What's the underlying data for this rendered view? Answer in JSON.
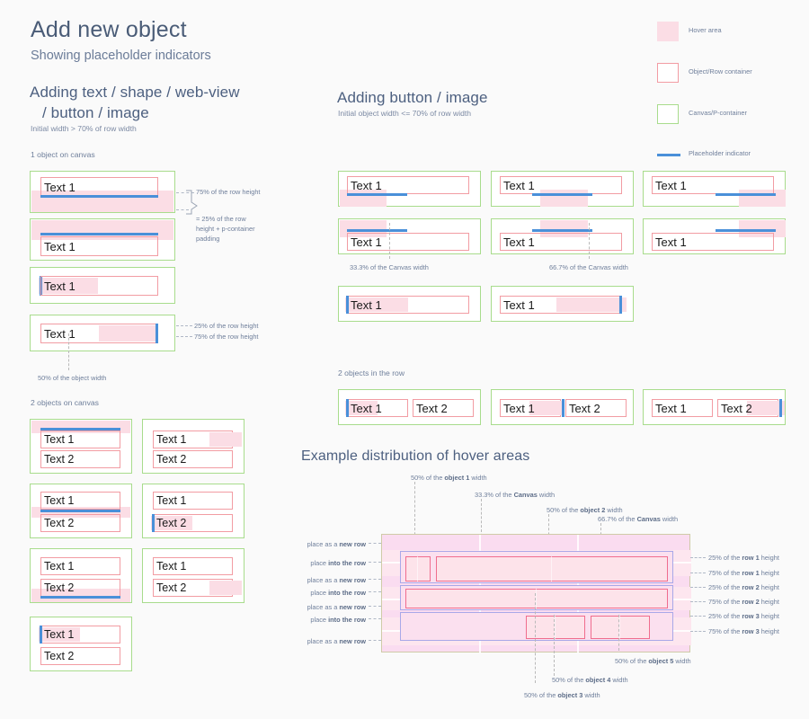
{
  "header": {
    "title": "Add new object",
    "subtitle": "Showing placeholder indicators"
  },
  "legend": {
    "items": [
      {
        "label": "Hover area",
        "swatch": "filled-pink-square",
        "color": "#fbdde5"
      },
      {
        "label": "Object/Row container",
        "swatch": "red-outline-square",
        "color": "#f29ca3"
      },
      {
        "label": "Canvas/P-container",
        "swatch": "green-outline-square",
        "color": "#a8dc8c"
      },
      {
        "label": "Placeholder indicator",
        "swatch": "blue-line",
        "color": "#4a90d9"
      }
    ]
  },
  "left_column": {
    "heading_line1": "Adding text / shape / web-view",
    "heading_line2": "/ button / image",
    "subheading": "Initial width > 70% of row width",
    "group1_caption": "1 object on canvas",
    "group2_caption": "2 objects on canvas",
    "annotations": {
      "a1": "75% of the row height",
      "a2_line1": "= 25% of the row",
      "a2_line2": "height + p-container",
      "a2_line3": "padding",
      "a3": "25% of the row height",
      "a4": "75% of the row height",
      "a5": "50% of the object width"
    },
    "object_labels": {
      "text1": "Text 1",
      "text2": "Text 2"
    }
  },
  "middle_column": {
    "heading": "Adding button / image",
    "subheading": "Initial object width <= 70% of row width",
    "annotations": {
      "canvas_33": "33.3% of the Canvas width",
      "canvas_667": "66.7% of the Canvas width"
    },
    "group_caption": "2 objects in the row",
    "object_labels": {
      "text1": "Text 1",
      "text2": "Text 2"
    }
  },
  "hover_example": {
    "heading": "Example distribution of hover areas",
    "top_annotations": [
      "50% of the object 1 width",
      "33.3% of the Canvas width",
      "50% of the object 2 width",
      "66.7% of the Canvas width"
    ],
    "top_annotations_rich": [
      {
        "pre": "50% of the ",
        "bold": "object 1",
        "post": " width"
      },
      {
        "pre": "33.3% of the ",
        "bold": "Canvas",
        "post": " width"
      },
      {
        "pre": "50% of the ",
        "bold": "object 2",
        "post": " width"
      },
      {
        "pre": "66.7% of the ",
        "bold": "Canvas",
        "post": " width"
      }
    ],
    "left_annotations": [
      {
        "pre": "place as a ",
        "bold": "new row",
        "post": ""
      },
      {
        "pre": "place ",
        "bold": "into the row",
        "post": ""
      },
      {
        "pre": "place as a ",
        "bold": "new row",
        "post": ""
      },
      {
        "pre": "place ",
        "bold": "into the row",
        "post": ""
      },
      {
        "pre": "place as a ",
        "bold": "new row",
        "post": ""
      },
      {
        "pre": "place ",
        "bold": "into the row",
        "post": ""
      },
      {
        "pre": "place as a ",
        "bold": "new row",
        "post": ""
      }
    ],
    "right_annotations": [
      {
        "pre": "25% of the ",
        "bold": "row 1",
        "post": " height"
      },
      {
        "pre": "75% of the ",
        "bold": "row 1",
        "post": " height"
      },
      {
        "pre": "25% of the ",
        "bold": "row 2",
        "post": " height"
      },
      {
        "pre": "75% of the ",
        "bold": "row 2",
        "post": " height"
      },
      {
        "pre": "25% of the ",
        "bold": "row 3",
        "post": " height"
      },
      {
        "pre": "75% of the ",
        "bold": "row 3",
        "post": " height"
      }
    ],
    "bottom_annotations": [
      {
        "pre": "50% of the ",
        "bold": "object 5",
        "post": " width"
      },
      {
        "pre": "50% of the ",
        "bold": "object 4",
        "post": " width"
      },
      {
        "pre": "50% of the ",
        "bold": "object 3",
        "post": " width"
      }
    ]
  },
  "colors": {
    "background": "#fafafa",
    "title": "#4a5c77",
    "text": "#6f7f9b",
    "hover_area": "#fbdde5",
    "object_border": "#f29ca3",
    "canvas_border": "#a8dc8c",
    "placeholder": "#4a90d9",
    "row_border": "#a9a8e8",
    "hd_canvas": "#fadcf0"
  }
}
